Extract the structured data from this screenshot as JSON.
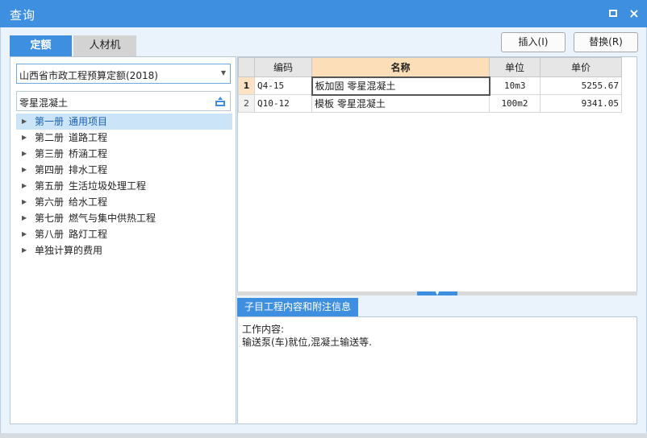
{
  "window": {
    "title": "查询",
    "max_icon": "maximize-icon",
    "close_icon": "close-icon",
    "close_glyph": "×"
  },
  "tabs": [
    {
      "label": "定额",
      "active": true
    },
    {
      "label": "人材机",
      "active": false
    }
  ],
  "actions": {
    "insert_label": "插入(I)",
    "replace_label": "替换(R)"
  },
  "library_select": {
    "value": "山西省市政工程预算定额(2018)",
    "arrow_glyph": "▼"
  },
  "search": {
    "value": "零星混凝土",
    "icon": "search-filter-icon"
  },
  "tree": {
    "caret_glyph": "▶",
    "items": [
      {
        "volume": "第一册",
        "label": "通用项目",
        "selected": true
      },
      {
        "volume": "第二册",
        "label": "道路工程",
        "selected": false
      },
      {
        "volume": "第三册",
        "label": "桥涵工程",
        "selected": false
      },
      {
        "volume": "第四册",
        "label": "排水工程",
        "selected": false
      },
      {
        "volume": "第五册",
        "label": "生活垃圾处理工程",
        "selected": false
      },
      {
        "volume": "第六册",
        "label": "给水工程",
        "selected": false
      },
      {
        "volume": "第七册",
        "label": "燃气与集中供热工程",
        "selected": false
      },
      {
        "volume": "第八册",
        "label": "路灯工程",
        "selected": false
      },
      {
        "volume": "",
        "label": "单独计算的费用",
        "selected": false
      }
    ]
  },
  "grid": {
    "columns": {
      "code": "编码",
      "name": "名称",
      "unit": "单位",
      "price": "单价"
    },
    "rows": [
      {
        "no": "1",
        "code": "Q4-15",
        "name": "板加固 零星混凝土",
        "unit": "10m3",
        "price": "5255.67",
        "active": true
      },
      {
        "no": "2",
        "code": "Q10-12",
        "name": "模板 零星混凝土",
        "unit": "100m2",
        "price": "9341.05",
        "active": false
      }
    ]
  },
  "splitter": {
    "grip_glyph": "▼"
  },
  "info": {
    "tab_label": "子目工程内容和附注信息",
    "content_title": "工作内容:",
    "content_text": "输送泵(车)就位,混凝土输送等."
  },
  "colors": {
    "accent": "#3f8fe0",
    "panel_bg": "#eaf2fb",
    "header_highlight": "#fcdfb8",
    "selected_tree": "#cce4f7"
  }
}
